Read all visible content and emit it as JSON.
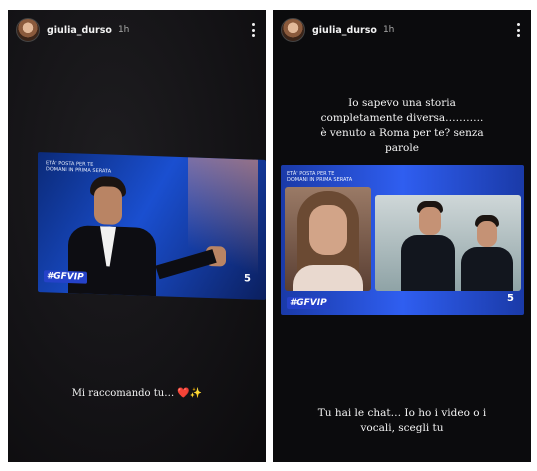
{
  "stories": [
    {
      "username": "giulia_durso",
      "time": "1h",
      "tv": {
        "badge": "ETÀ' POSTA PER TE\nDOMANI IN PRIMA SERATA",
        "show_logo": "#GFVIP",
        "channel": "5"
      },
      "caption": "Mi raccomando tu… ❤️✨"
    },
    {
      "username": "giulia_durso",
      "time": "1h",
      "text_top": "Io sapevo una storia completamente diversa……….. è venuto a Roma per te? senza parole",
      "tv": {
        "badge": "ETÀ' POSTA PER TE\nDOMANI IN PRIMA SERATA",
        "show_logo": "#GFVIP",
        "channel": "5"
      },
      "caption": "Tu hai le chat… Io ho i video o i vocali, scegli tu"
    }
  ]
}
